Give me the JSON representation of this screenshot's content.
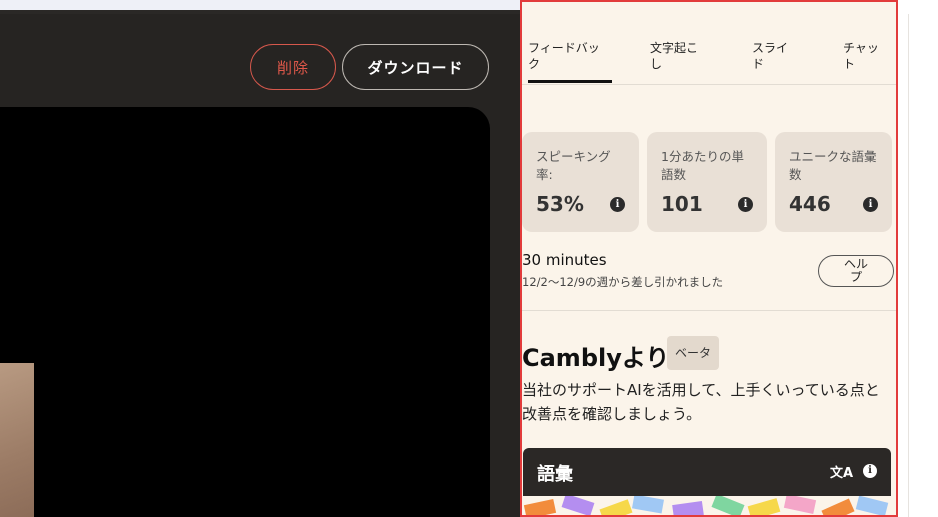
{
  "header": {
    "delete_label": "削除",
    "download_label": "ダウンロード"
  },
  "tabs": [
    {
      "line1": "フィードバッ",
      "line2": "ク",
      "active": true
    },
    {
      "line1": "文字起こ",
      "line2": "し",
      "active": false
    },
    {
      "line1": "スライ",
      "line2": "ド",
      "active": false
    },
    {
      "line1": "チャッ",
      "line2": "ト",
      "active": false
    }
  ],
  "stats": [
    {
      "label_line1": "スピーキング",
      "label_line2": "率:",
      "value": "53%",
      "icon": "info-icon"
    },
    {
      "label_line1": "1分あたりの単",
      "label_line2": "語数",
      "value": "101",
      "icon": "info-icon"
    },
    {
      "label_line1": "ユニークな語彙",
      "label_line2": "数",
      "value": "446",
      "icon": "info-icon"
    }
  ],
  "time": {
    "title": "30 minutes",
    "subtitle": "12/2〜12/9の週から差し引かれました"
  },
  "help_button": {
    "line1": "ヘル",
    "line2": "プ"
  },
  "ai_section": {
    "title": "Camblyより",
    "badge": "ベータ",
    "description": "当社のサポートAIを活用して、上手くいっている点と改善点を確認しましょう。"
  },
  "vocab": {
    "title": "語彙",
    "translate_icon_glyph": "文A",
    "info_icon_glyph": "i"
  },
  "colors": {
    "accent_red": "#e0584a",
    "panel_bg": "#fbf4ea",
    "stat_bg": "#e9e0d6",
    "frame_red": "#e23b3b",
    "dark_bg": "#262422"
  }
}
